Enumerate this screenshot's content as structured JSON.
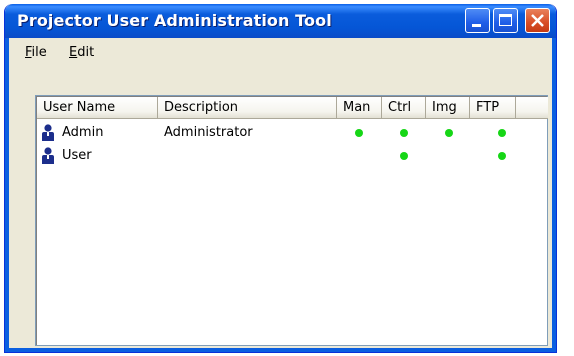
{
  "window": {
    "title": "Projector User Administration Tool"
  },
  "menu": {
    "file_mnemonic": "F",
    "file_rest": "ile",
    "edit_mnemonic": "E",
    "edit_rest": "dit"
  },
  "table": {
    "columns": [
      "User Name",
      "Description",
      "Man",
      "Ctrl",
      "Img",
      "FTP"
    ],
    "rows": [
      {
        "name": "Admin",
        "description": "Administrator",
        "man": true,
        "ctrl": true,
        "img": true,
        "ftp": true
      },
      {
        "name": "User",
        "description": "",
        "man": false,
        "ctrl": true,
        "img": false,
        "ftp": true
      }
    ]
  },
  "colors": {
    "permission_dot": "#16d616",
    "titlebar": "#0556d6",
    "user_icon": "#1c2e8c"
  },
  "icons": {
    "row_icon": "user-icon",
    "minimize": "minimize-icon",
    "maximize": "maximize-icon",
    "close": "close-icon"
  }
}
